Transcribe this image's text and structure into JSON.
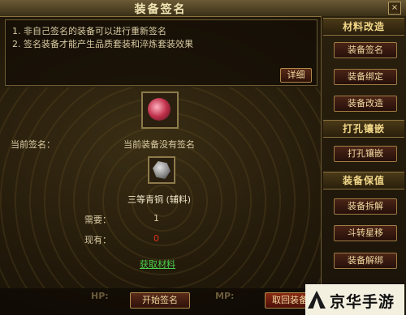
{
  "window": {
    "title": "装备签名",
    "close_label": "×"
  },
  "info": {
    "line1": "1. 非自己签名的装备可以进行重新签名",
    "line2": "2. 签名装备才能产生品质套装和淬炼套装效果",
    "detail_button": "详细"
  },
  "equipment": {
    "current_sign_label": "当前签名：",
    "current_sign_value": "当前装备没有签名",
    "material_name": "三等青铜 (辅料)",
    "need_label": "需要：",
    "need_value": "1",
    "have_label": "现有：",
    "have_value": "0",
    "get_material_link": "获取材料"
  },
  "actions": {
    "start_button": "开始签名",
    "cancel_button": "取回装备"
  },
  "background_text": {
    "hp_label": "HP:",
    "mp_label": "MP:"
  },
  "sidebar": {
    "sections": [
      {
        "title": "材料改造",
        "buttons": [
          "装备签名",
          "装备绑定",
          "装备改造"
        ]
      },
      {
        "title": "打孔镶嵌",
        "buttons": [
          "打孔镶嵌"
        ]
      },
      {
        "title": "装备保值",
        "buttons": [
          "装备拆解",
          "斗转星移",
          "装备解绑"
        ]
      }
    ]
  },
  "watermark": {
    "text": "京华手游"
  },
  "colors": {
    "accent_gold": "#f3d88a",
    "have_red": "#e03020",
    "link_green": "#4cd24c"
  }
}
